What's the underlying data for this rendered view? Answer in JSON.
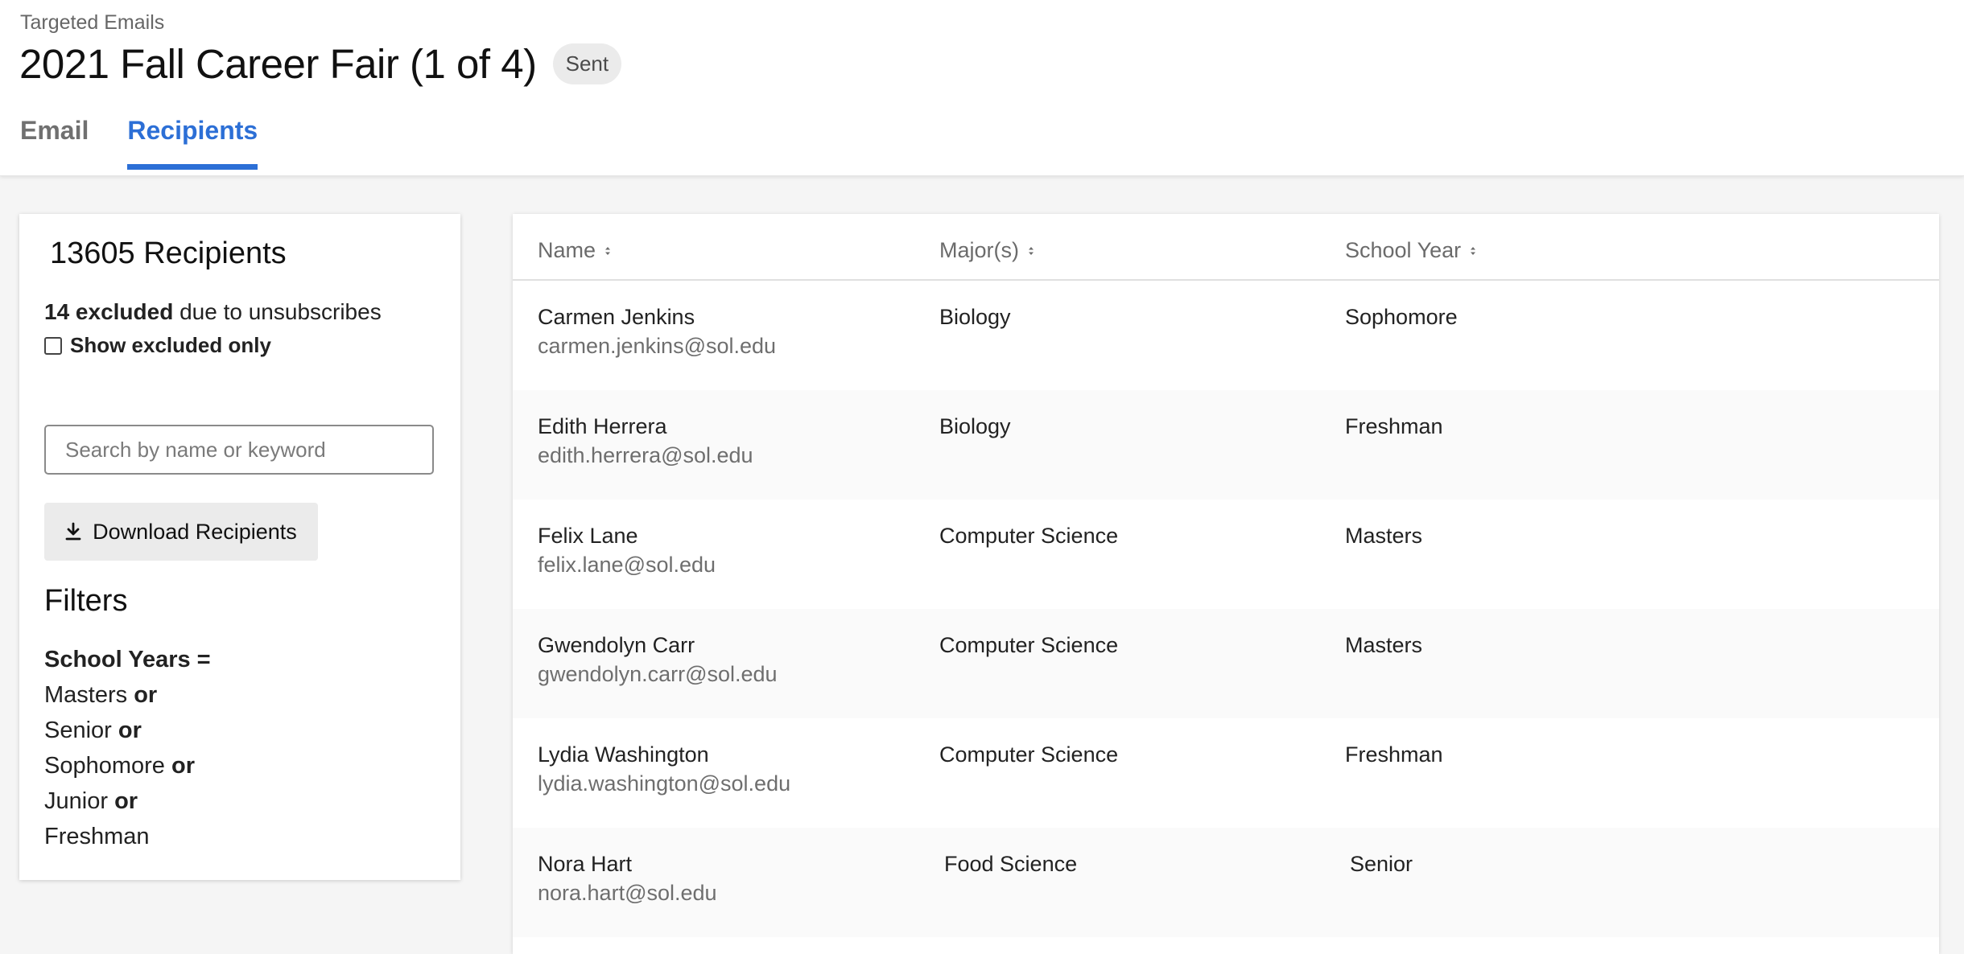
{
  "header": {
    "breadcrumb": "Targeted Emails",
    "title": "2021 Fall Career Fair (1 of 4)",
    "status": "Sent",
    "tabs": [
      {
        "label": "Email",
        "active": false
      },
      {
        "label": "Recipients",
        "active": true
      }
    ]
  },
  "sidebar": {
    "recipient_count": "13605 Recipients",
    "excluded_count": "14 excluded",
    "excluded_reason": "due to unsubscribes",
    "show_excluded_label": "Show excluded only",
    "show_excluded_checked": false,
    "search_placeholder": "Search by name or keyword",
    "download_label": "Download Recipients",
    "filters_heading": "Filters",
    "filter_field": "School Years =",
    "filter_connector": "or",
    "filter_values": [
      "Masters",
      "Senior",
      "Sophomore",
      "Junior",
      "Freshman"
    ]
  },
  "table": {
    "columns": [
      "Name",
      "Major(s)",
      "School Year"
    ],
    "rows": [
      {
        "name": "Carmen Jenkins",
        "email": "carmen.jenkins@sol.edu",
        "major": "Biology",
        "year": "Sophomore"
      },
      {
        "name": "Edith Herrera",
        "email": "edith.herrera@sol.edu",
        "major": "Biology",
        "year": "Freshman"
      },
      {
        "name": "Felix Lane",
        "email": "felix.lane@sol.edu",
        "major": "Computer Science",
        "year": "Masters"
      },
      {
        "name": "Gwendolyn Carr",
        "email": "gwendolyn.carr@sol.edu",
        "major": "Computer Science",
        "year": "Masters"
      },
      {
        "name": "Lydia Washington",
        "email": "lydia.washington@sol.edu",
        "major": "Computer Science",
        "year": "Freshman"
      },
      {
        "name": "Nora Hart",
        "email": "nora.hart@sol.edu",
        "major": "Food Science",
        "year": "Senior"
      }
    ]
  },
  "colors": {
    "accent": "#2c6fd6",
    "badge_bg": "#ebebeb"
  },
  "icons": {
    "download": "download-icon",
    "sort": "sort-icon",
    "checkbox": "checkbox-icon"
  }
}
